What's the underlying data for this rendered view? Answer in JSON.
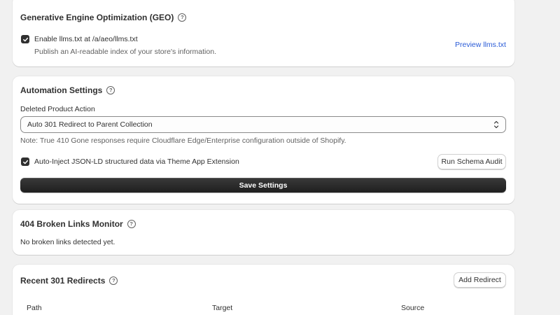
{
  "geo": {
    "title": "Generative Engine Optimization (GEO)",
    "help_glyph": "?",
    "checkbox_label": "Enable llms.txt at /a/aeo/llms.txt",
    "checkbox_checked": true,
    "description": "Publish an AI-readable index of your store's information.",
    "preview_link": "Preview llms.txt"
  },
  "automation": {
    "title": "Automation Settings",
    "help_glyph": "?",
    "deleted_action_label": "Deleted Product Action",
    "deleted_action_value": "Auto 301 Redirect to Parent Collection",
    "note": "Note: True 410 Gone responses require Cloudflare Edge/Enterprise configuration outside of Shopify.",
    "jsonld_label": "Auto-Inject JSON-LD structured data via Theme App Extension",
    "jsonld_checked": true,
    "run_audit_label": "Run Schema Audit",
    "save_label": "Save Settings"
  },
  "broken_links": {
    "title": "404 Broken Links Monitor",
    "help_glyph": "?",
    "empty_message": "No broken links detected yet."
  },
  "redirects": {
    "title": "Recent 301 Redirects",
    "help_glyph": "?",
    "add_label": "Add Redirect",
    "columns": [
      "Path",
      "Target",
      "Source"
    ]
  },
  "colors": {
    "background": "#f1f1f1",
    "card": "#ffffff",
    "primary_button": "#303030",
    "link": "#2a5bd7"
  }
}
